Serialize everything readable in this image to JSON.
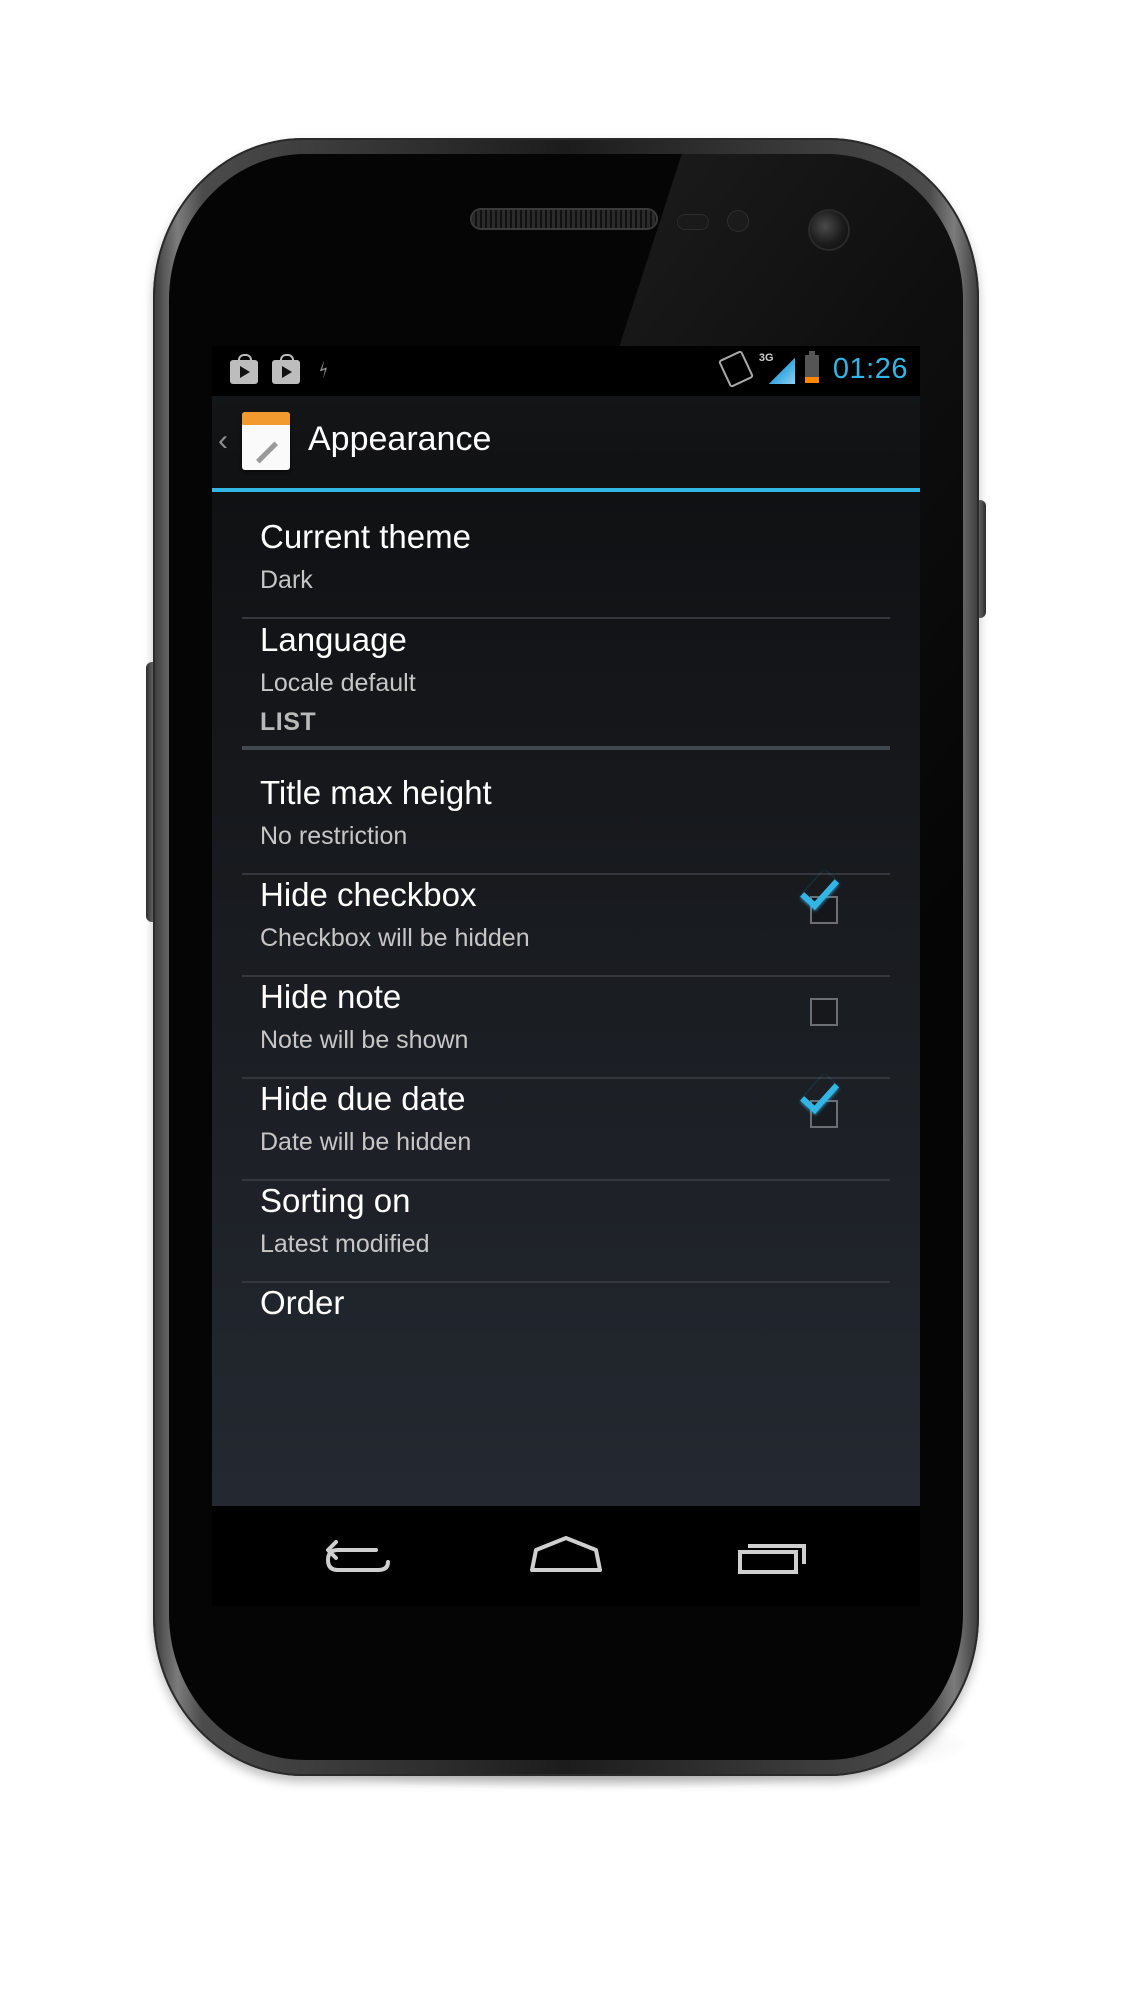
{
  "statusbar": {
    "left_icons": [
      "play-store-icon",
      "play-store-icon",
      "usb-icon"
    ],
    "right_icons": [
      "vibrate-icon",
      "signal-3g-icon",
      "battery-icon"
    ],
    "network_label": "3G",
    "clock": "01:26",
    "battery_level": 0.22,
    "accent_color": "#33b5e5"
  },
  "actionbar": {
    "title": "Appearance",
    "icon": "notepad-icon"
  },
  "preferences": [
    {
      "title": "Current theme",
      "summary": "Dark"
    },
    {
      "title": "Language",
      "summary": "Locale default"
    }
  ],
  "list_category": {
    "label": "LIST",
    "items": [
      {
        "title": "Title max height",
        "summary": "No restriction"
      },
      {
        "title": "Hide checkbox",
        "summary": "Checkbox will be hidden",
        "checked": true
      },
      {
        "title": "Hide note",
        "summary": "Note will be shown",
        "checked": false
      },
      {
        "title": "Hide due date",
        "summary": "Date will be hidden",
        "checked": true
      },
      {
        "title": "Sorting on",
        "summary": "Latest modified"
      },
      {
        "title": "Order",
        "summary": ""
      }
    ]
  },
  "navbar": {
    "buttons": [
      "back-icon",
      "home-icon",
      "recent-apps-icon"
    ]
  }
}
